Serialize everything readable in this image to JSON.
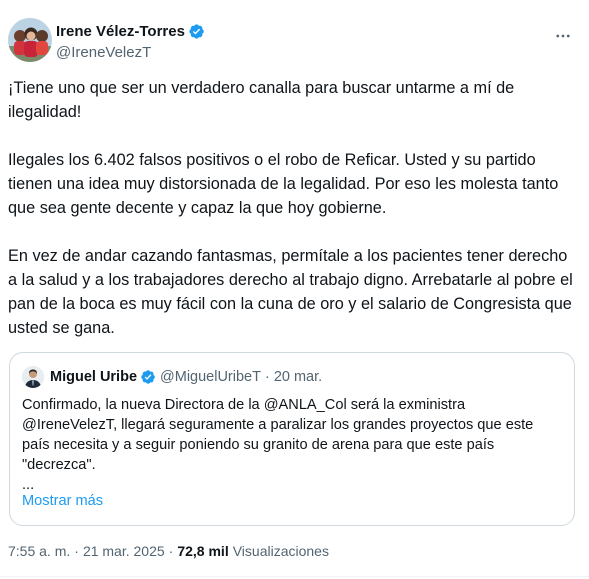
{
  "author": {
    "display_name": "Irene Vélez-Torres",
    "handle": "@IreneVelezT"
  },
  "tweet": {
    "paragraphs": [
      "¡Tiene uno que ser un verdadero canalla para buscar untarme a mí de ilegalidad!",
      "Ilegales los 6.402 falsos positivos o el robo de Reficar. Usted y su partido tienen una idea muy distorsionada de la legalidad. Por eso les molesta tanto que sea gente decente y capaz la que hoy gobierne.",
      "En vez de andar cazando fantasmas, permítale a los pacientes tener derecho a la salud y a los trabajadores derecho al trabajo digno. Arrebatarle al pobre el pan de la boca es muy fácil con la cuna de oro y el salario de Congresista que usted se gana."
    ]
  },
  "quote": {
    "display_name": "Miguel Uribe",
    "handle": "@MiguelUribeT",
    "separator": "·",
    "date": "20 mar.",
    "text": "Confirmado, la nueva Directora de la @ANLA_Col será la exministra @IreneVelezT, llegará seguramente a paralizar los grandes proyectos que este país necesita y a seguir poniendo su granito de arena para que este país \"decrezca\".",
    "ellipsis": "...",
    "show_more": "Mostrar más"
  },
  "meta": {
    "time": "7:55 a. m.",
    "separator": "·",
    "date": "21 mar. 2025",
    "views_count": "72,8 mil",
    "views_label": "Visualizaciones"
  },
  "colors": {
    "verified": "#1d9bf0",
    "link": "#1d9bf0",
    "secondary_text": "#536471",
    "border": "#cfd9de"
  },
  "icons": {
    "verified": "verified-badge-icon",
    "more": "more-horizontal-icon"
  }
}
